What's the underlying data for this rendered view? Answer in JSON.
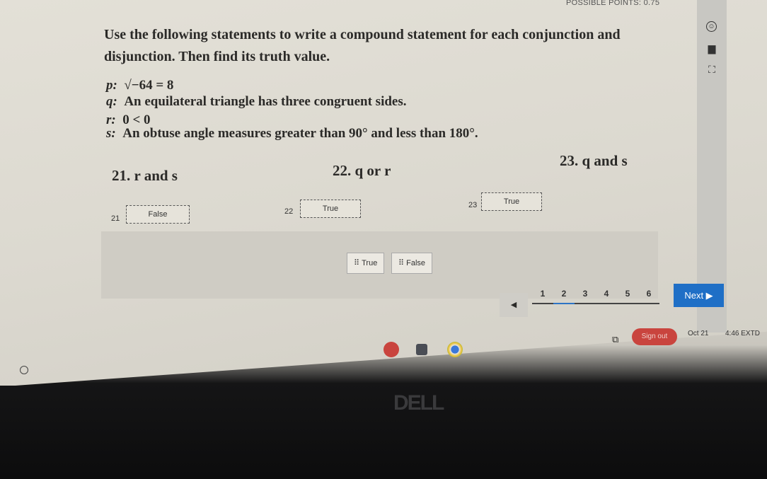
{
  "header": {
    "possible_points": "POSSIBLE POINTS: 0.75"
  },
  "sidebar_icons": [
    "accessibility-icon",
    "calculator-icon",
    "fullscreen-icon"
  ],
  "question": {
    "instructions": "Use the following statements to write a compound statement for each conjunction and disjunction. Then find its truth value.",
    "statements": [
      {
        "label": "p:",
        "text": "√−64 = 8"
      },
      {
        "label": "q:",
        "text": "An equilateral triangle has three congruent sides."
      },
      {
        "label": "r:",
        "text": "0 < 0"
      },
      {
        "label": "s:",
        "text": "An obtuse angle measures greater than 90° and less than 180°."
      }
    ],
    "parts": [
      {
        "number": "21.",
        "text": "r and s",
        "answer_label": "21",
        "answer": "False"
      },
      {
        "number": "22.",
        "text": "q or r",
        "answer_label": "22",
        "answer": "True"
      },
      {
        "number": "23.",
        "text": "q and s",
        "answer_label": "23",
        "answer": "True"
      }
    ]
  },
  "answer_bank": [
    {
      "label": "True"
    },
    {
      "label": "False"
    }
  ],
  "pagination": {
    "prev": "◀",
    "pages": [
      "1",
      "2",
      "3",
      "4",
      "5",
      "6"
    ],
    "current": "2",
    "next": "Next ▶"
  },
  "taskbar": {
    "sign_out": "Sign out",
    "date": "Oct 21",
    "time": "4:46 EXTD"
  },
  "bezel_logo": "DELL",
  "colors": {
    "next_button": "#1f6fc6",
    "sign_out": "#c9443e"
  }
}
